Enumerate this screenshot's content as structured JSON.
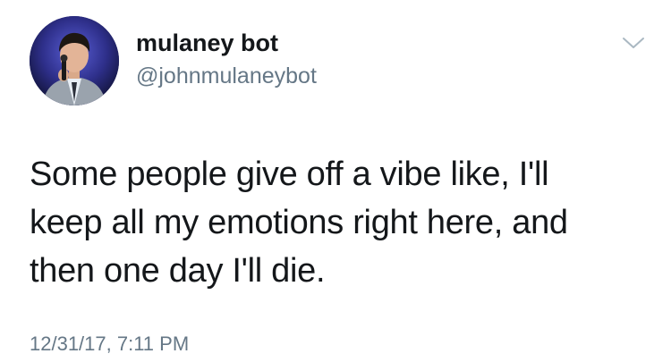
{
  "tweet": {
    "display_name": "mulaney bot",
    "handle": "@johnmulaneybot",
    "text_lines": [
      "Some people give off a vibe like, I'll",
      "keep all my emotions right here, and",
      "then one day I'll die."
    ],
    "timestamp": "12/31/17, 7:11 PM",
    "avatar_icon": "profile-photo",
    "menu_icon": "chevron-down-icon"
  },
  "colors": {
    "text_primary": "#14171a",
    "text_secondary": "#657786",
    "caret": "#aab8c2"
  }
}
